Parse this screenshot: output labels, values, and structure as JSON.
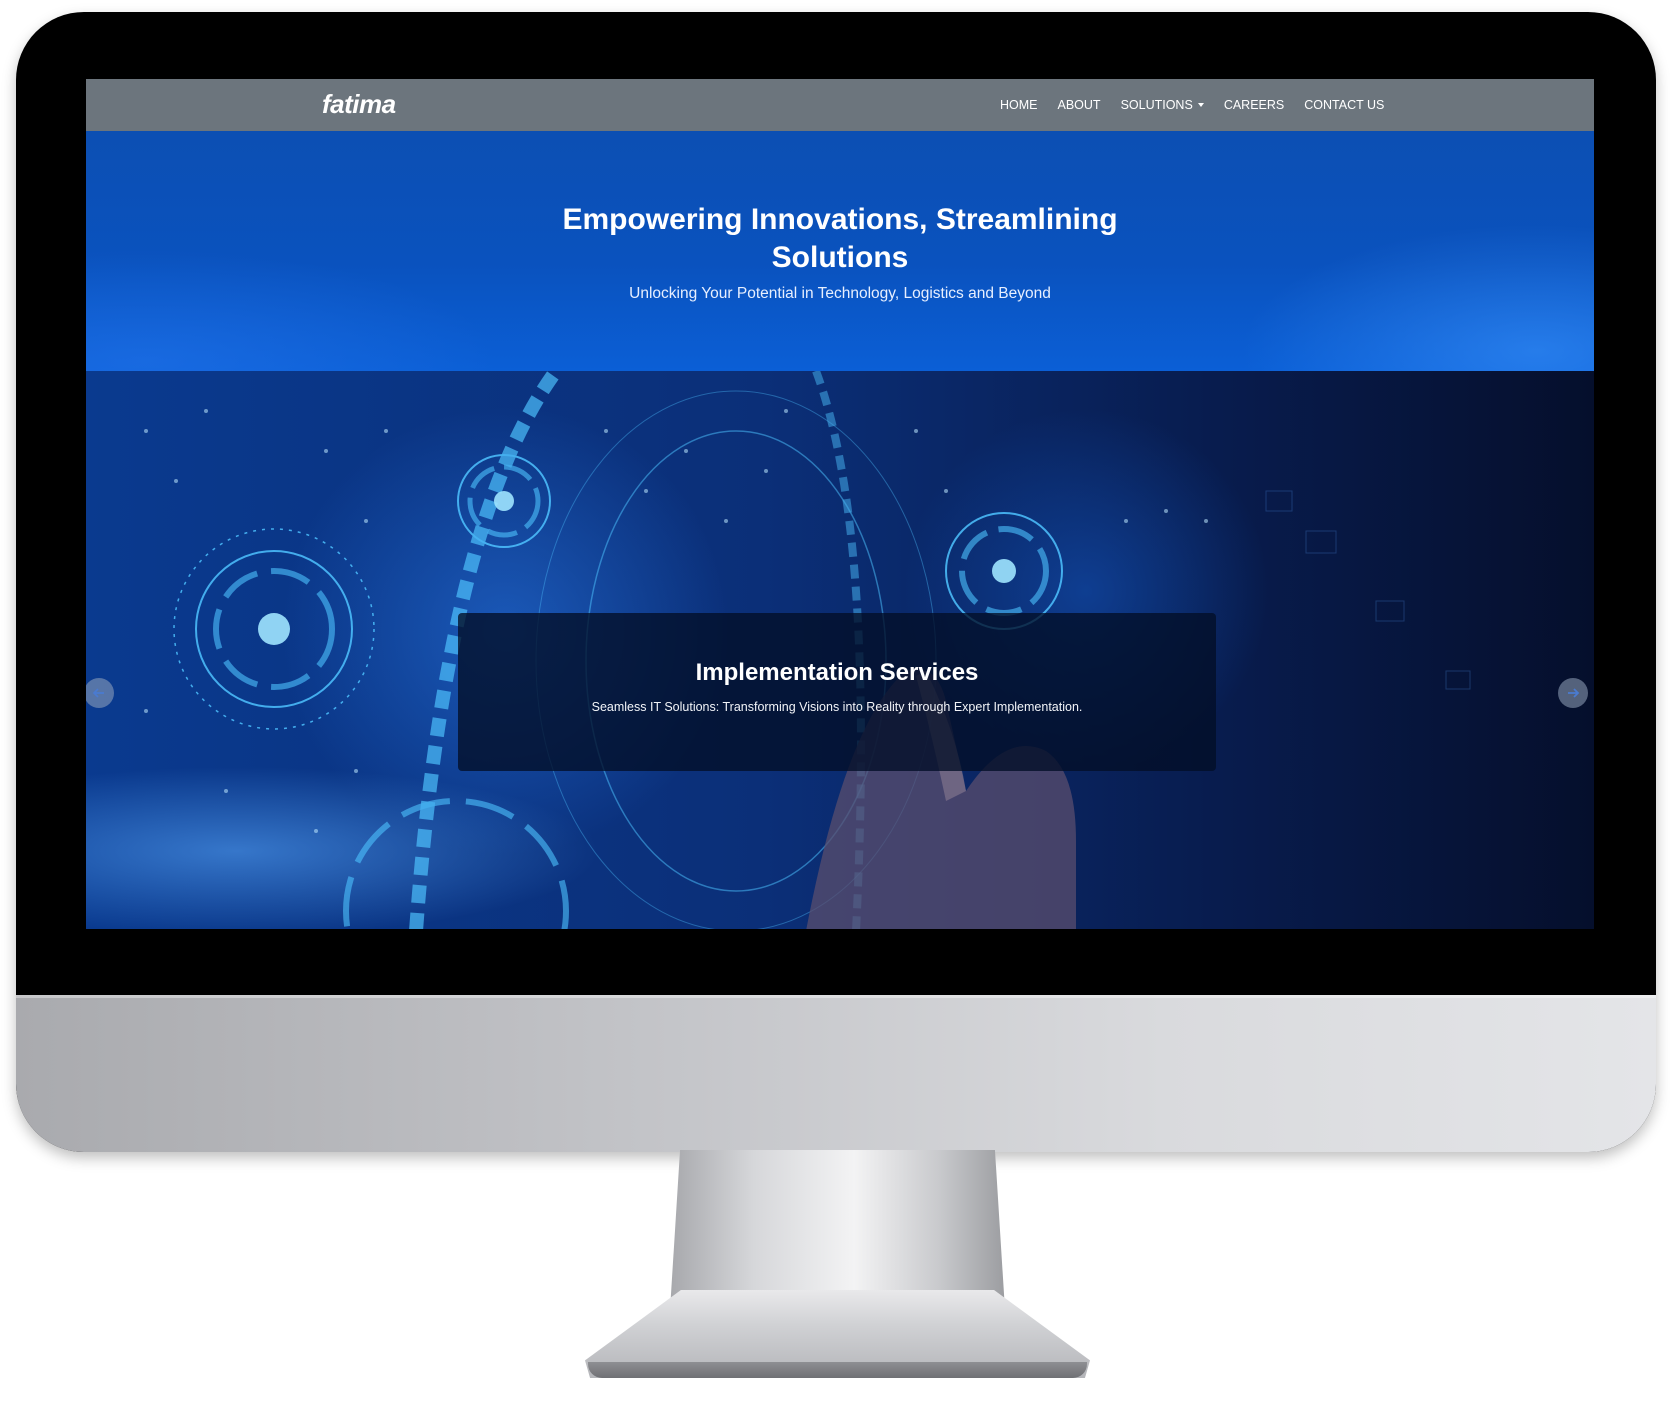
{
  "navbar": {
    "brand": "fatima",
    "links": [
      {
        "label": "HOME"
      },
      {
        "label": "ABOUT"
      },
      {
        "label": "SOLUTIONS"
      },
      {
        "label": "CAREERS"
      },
      {
        "label": "CONTACT US"
      }
    ]
  },
  "hero": {
    "title_line1": "Empowering Innovations, Streamlining",
    "title_line2": "Solutions",
    "subtitle": "Unlocking Your Potential in Technology, Logistics and Beyond"
  },
  "carousel": {
    "caption_title": "Implementation Services",
    "caption_text": "Seamless IT Solutions: Transforming Visions into Reality through Expert Implementation."
  },
  "colors": {
    "navbar": "#6c757d",
    "hero_blue": "#0a52be",
    "caption_bg": "#020e26",
    "glow": "#4fc3ff"
  },
  "icons": [
    "chevron-left-icon",
    "chevron-right-icon",
    "caret-down-icon"
  ]
}
